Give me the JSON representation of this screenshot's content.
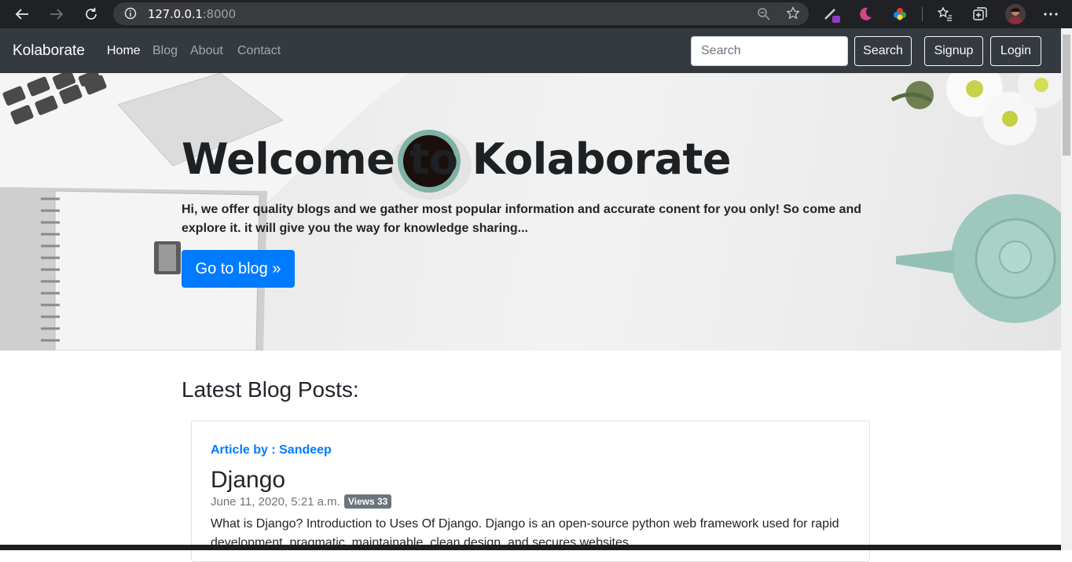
{
  "browser": {
    "url_host": "127.0.0.1",
    "url_port": ":8000"
  },
  "navbar": {
    "brand": "Kolaborate",
    "links": [
      "Home",
      "Blog",
      "About",
      "Contact"
    ],
    "search_placeholder": "Search",
    "search_button": "Search",
    "signup_button": "Signup",
    "login_button": "Login"
  },
  "hero": {
    "title": "Welcome to Kolaborate",
    "text": "Hi, we offer quality blogs and we gather most popular information and accurate conent for you only! So come and explore it. it will give you the way for knowledge sharing...",
    "button": "Go to blog »"
  },
  "main": {
    "section_title": "Latest Blog Posts:",
    "post": {
      "author": "Article by : Sandeep",
      "title": "Django",
      "date": "June 11, 2020, 5:21 a.m.",
      "views_badge": "Views 33",
      "excerpt": "What is Django? Introduction to Uses Of Django. Django is an open-source python web framework used for rapid development, pragmatic, maintainable, clean design, and secures websites. ......"
    }
  },
  "colors": {
    "navbar_bg": "#343a40",
    "primary": "#007bff",
    "badge": "#6c757d"
  }
}
